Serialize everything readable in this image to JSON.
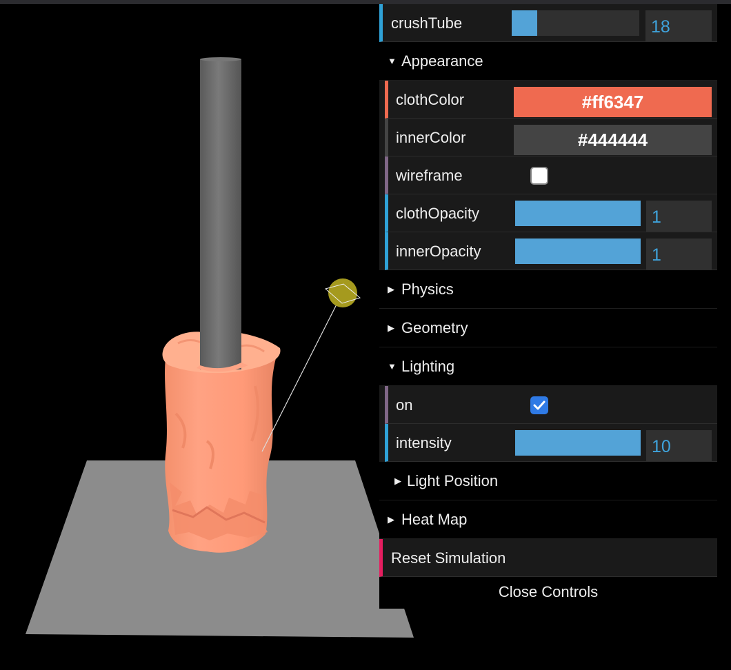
{
  "panel": {
    "crushTube": {
      "label": "crushTube",
      "value": "18",
      "fraction": 0.2
    },
    "appearance": {
      "title": "Appearance",
      "clothColor": {
        "label": "clothColor",
        "value": "#ff6347",
        "color": "#ef6a50"
      },
      "innerColor": {
        "label": "innerColor",
        "value": "#444444",
        "color": "#444444"
      },
      "wireframe": {
        "label": "wireframe",
        "checked": false
      },
      "clothOpacity": {
        "label": "clothOpacity",
        "value": "1",
        "fraction": 1.0
      },
      "innerOpacity": {
        "label": "innerOpacity",
        "value": "1",
        "fraction": 1.0
      }
    },
    "physics": {
      "title": "Physics"
    },
    "geometry": {
      "title": "Geometry"
    },
    "lighting": {
      "title": "Lighting",
      "on": {
        "label": "on",
        "checked": true
      },
      "intensity": {
        "label": "intensity",
        "value": "10",
        "fraction": 1.0
      },
      "light_position": {
        "title": "Light Position"
      }
    },
    "heat_map": {
      "title": "Heat Map"
    },
    "reset": {
      "label": "Reset Simulation"
    },
    "close": {
      "label": "Close Controls"
    }
  },
  "colors": {
    "slider_fill": "#53a3d7",
    "number_text": "#3fa3dc",
    "cloth": "#ff9a7a",
    "tube": "#6f6f6f",
    "floor": "#8c8c8c",
    "light_ball": "#a59a1e",
    "checkbox_on": "#2f7ae5"
  }
}
